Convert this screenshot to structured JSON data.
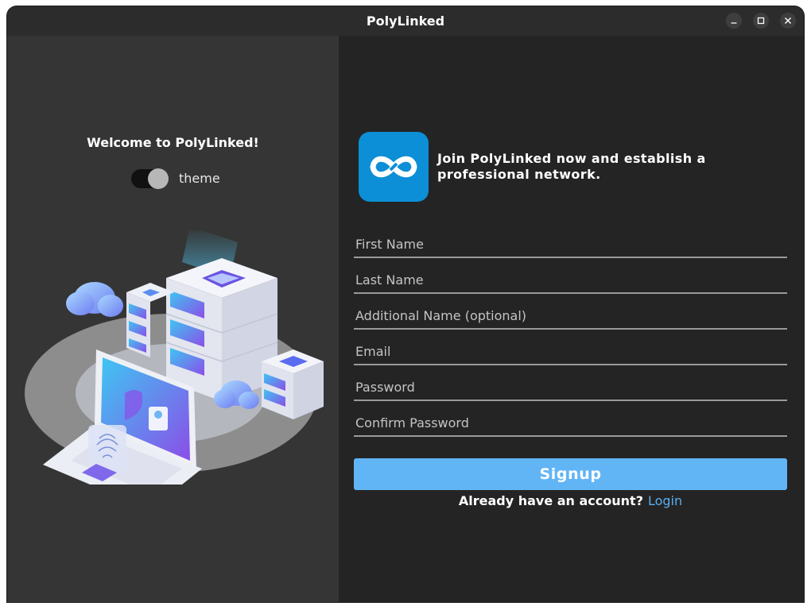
{
  "window": {
    "title": "PolyLinked"
  },
  "left": {
    "welcome": "Welcome to PolyLinked!",
    "theme_toggle": {
      "label": "theme",
      "state": "on"
    },
    "illustration": "server-security-illustration"
  },
  "right": {
    "logo": "infinity-logo",
    "tagline": "Join PolyLinked now and establish a professional network.",
    "fields": [
      {
        "placeholder": "First Name",
        "value": ""
      },
      {
        "placeholder": "Last Name",
        "value": ""
      },
      {
        "placeholder": "Additional Name (optional)",
        "value": ""
      },
      {
        "placeholder": "Email",
        "value": ""
      },
      {
        "placeholder": "Password",
        "value": ""
      },
      {
        "placeholder": "Confirm Password",
        "value": ""
      }
    ],
    "signup_label": "Signup",
    "login_prompt": "Already have an account?",
    "login_link": "Login"
  },
  "colors": {
    "accent": "#62b5f5",
    "link": "#5aaef0",
    "logo_bg": "#0c8fd6",
    "left_bg": "#353535",
    "right_bg": "#242424"
  }
}
